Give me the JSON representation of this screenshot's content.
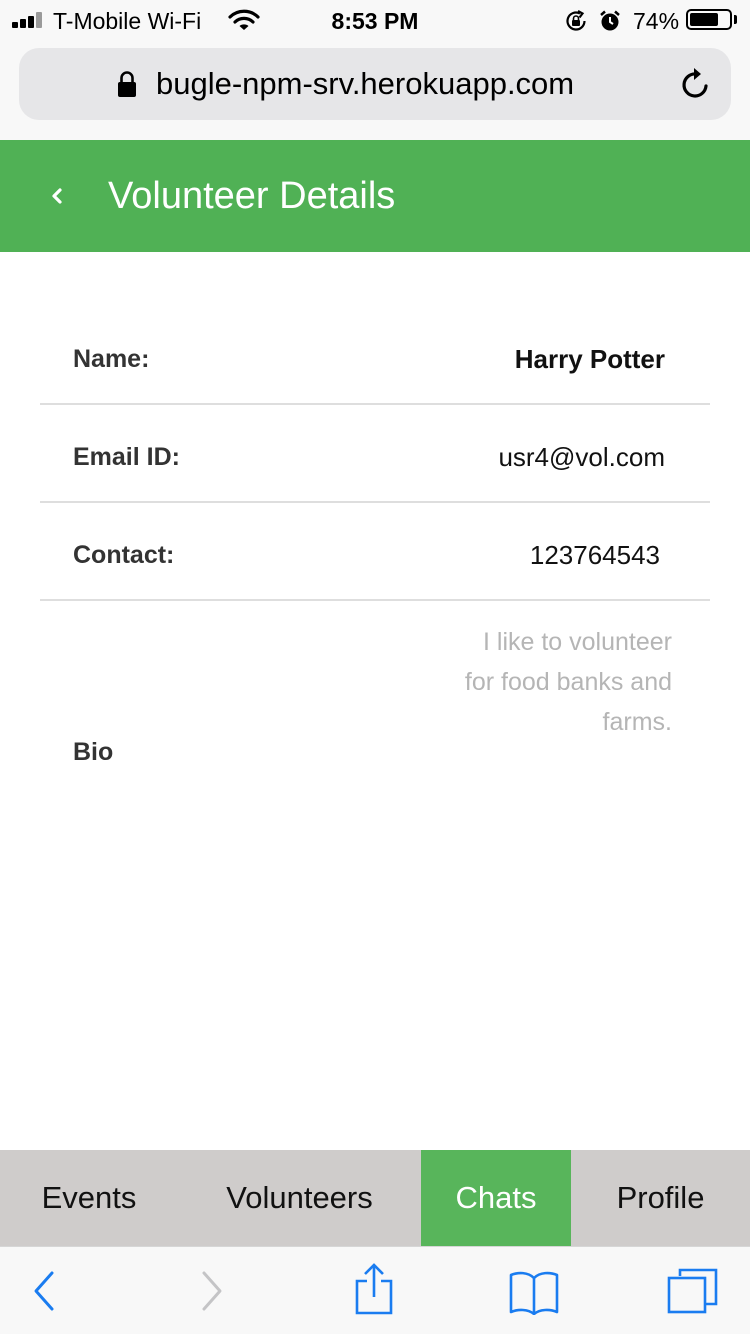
{
  "status_bar": {
    "carrier": "T-Mobile Wi-Fi",
    "time": "8:53 PM",
    "battery_percent": "74%",
    "battery_level": 0.74,
    "icons": [
      "signal-icon",
      "wifi-icon",
      "rotation-lock-icon",
      "alarm-icon",
      "battery-icon"
    ]
  },
  "browser": {
    "url": "bugle-npm-srv.herokuapp.com",
    "icons": [
      "lock-icon",
      "reload-icon"
    ]
  },
  "header": {
    "title": "Volunteer Details",
    "back_icon": "chevron-left-icon"
  },
  "details": {
    "name_label": "Name:",
    "name_value": "Harry Potter",
    "email_label": "Email ID:",
    "email_value": "usr4@vol.com",
    "contact_label": "Contact:",
    "contact_value": "123764543",
    "bio_label": "Bio",
    "bio_lines": [
      "I like to volunteer",
      "for food banks and",
      "farms."
    ]
  },
  "tabs": [
    {
      "label": "Events",
      "active": false
    },
    {
      "label": "Volunteers",
      "active": false
    },
    {
      "label": "Chats",
      "active": true
    },
    {
      "label": "Profile",
      "active": false
    }
  ],
  "colors": {
    "header_green": "#50b155",
    "active_tab_green": "#58b55b",
    "tab_bar_bg": "#cfcccb",
    "toolbar_blue": "#1a7cf0",
    "bio_text": "#b5b5b5"
  },
  "toolbar": {
    "icons": [
      "back-arrow-icon",
      "forward-arrow-icon",
      "share-icon",
      "bookmarks-icon",
      "tabs-icon"
    ]
  }
}
